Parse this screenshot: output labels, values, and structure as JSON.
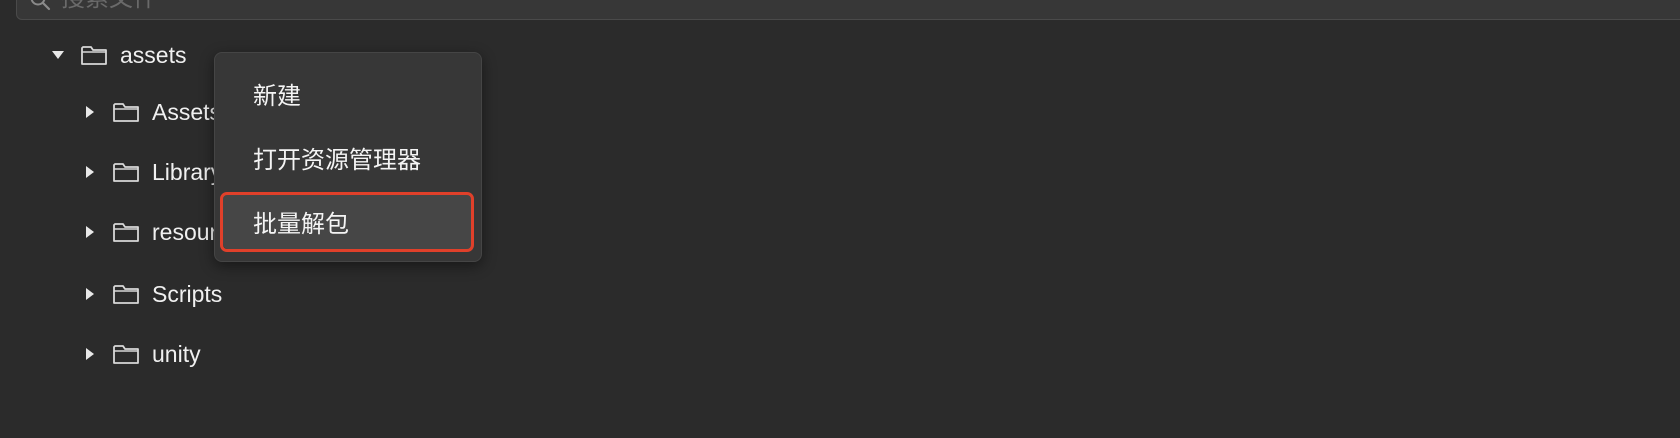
{
  "search": {
    "placeholder": "搜索文件"
  },
  "tree": {
    "root": {
      "label": "assets",
      "expanded": true
    },
    "children": [
      {
        "label": "Assets",
        "expanded": false
      },
      {
        "label": "Library",
        "expanded": false
      },
      {
        "label": "resources",
        "expanded": false
      },
      {
        "label": "Scripts",
        "expanded": false
      },
      {
        "label": "unity",
        "expanded": false
      }
    ]
  },
  "context_menu": {
    "items": [
      {
        "label": "新建"
      },
      {
        "label": "打开资源管理器"
      },
      {
        "label": "批量解包"
      }
    ],
    "highlighted_item": "批量解包"
  },
  "colors": {
    "background": "#2b2b2b",
    "menu_background": "#373737",
    "highlight_border": "#e0402a",
    "text": "#f0f0f0"
  },
  "icons": {
    "search": "search-icon",
    "folder": "folder-icon",
    "expanded_caret": "caret-down-icon",
    "collapsed_caret": "caret-right-icon"
  }
}
